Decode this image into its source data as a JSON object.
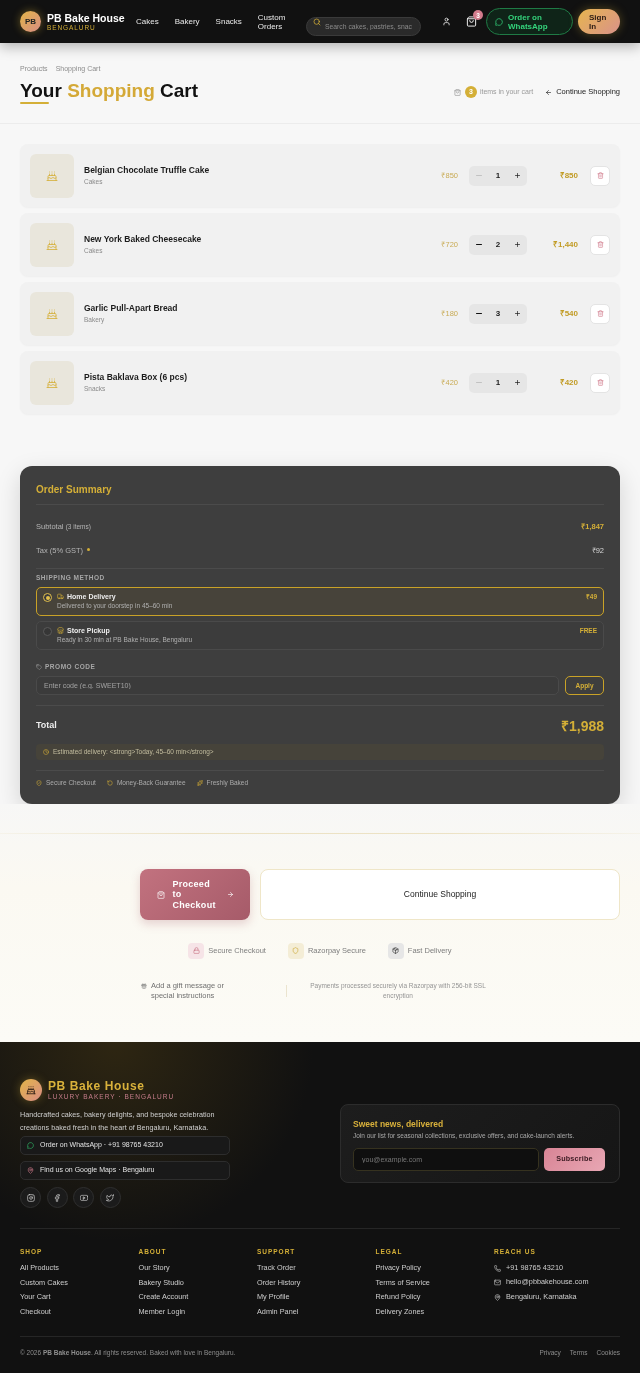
{
  "header": {
    "logo": {
      "initials": "PB",
      "name": "PB Bake House",
      "city": "BENGALURU"
    },
    "nav": [
      "Cakes",
      "Bakery",
      "Snacks",
      "Custom Orders"
    ],
    "search": {
      "placeholder": "Search cakes, pastries, snac"
    },
    "cart_count": "3",
    "whatsapp_button": "Order on WhatsApp",
    "sign_in_button": "Sign In"
  },
  "breadcrumb": [
    "Products",
    "Shopping Cart"
  ],
  "title": {
    "before": "Your",
    "highlight": "Shopping",
    "after": "Cart"
  },
  "cart_info": {
    "count": "3",
    "label": "items in your cart",
    "continue_link": "Continue Shopping"
  },
  "cart_items": [
    {
      "name": "Belgian Chocolate Truffle Cake",
      "category": "Cakes",
      "unit_price": "₹850",
      "quantity": "1",
      "total": "₹850",
      "decrease_disabled": true
    },
    {
      "name": "New York Baked Cheesecake",
      "category": "Cakes",
      "unit_price": "₹720",
      "quantity": "2",
      "total": "₹1,440",
      "decrease_disabled": false
    },
    {
      "name": "Garlic Pull-Apart Bread",
      "category": "Bakery",
      "unit_price": "₹180",
      "quantity": "3",
      "total": "₹540",
      "decrease_disabled": false
    },
    {
      "name": "Pista Baklava Box (6 pcs)",
      "category": "Snacks",
      "unit_price": "₹420",
      "quantity": "1",
      "total": "₹420",
      "decrease_disabled": true
    }
  ],
  "order_summary": {
    "title": "Order Summary",
    "subtotal": {
      "label": "Subtotal",
      "note": "(3 items)",
      "value": "₹1,847"
    },
    "tax": {
      "label": "Tax (5% GST)",
      "value": "₹92"
    },
    "shipping": {
      "label": "SHIPPING METHOD",
      "options": [
        {
          "name": "Home Delivery",
          "description": "Delivered to your doorstep in 45–60 min",
          "price": "₹49",
          "selected": true
        },
        {
          "name": "Store Pickup",
          "description": "Ready in 30 min at PB Bake House, Bengaluru",
          "price": "FREE",
          "selected": false
        }
      ]
    },
    "promo": {
      "label": "PROMO CODE",
      "placeholder": "Enter code (e.g. SWEET10)",
      "button": "Apply"
    },
    "total": {
      "label": "Total",
      "value": "₹1,988"
    },
    "estimate": "Estimated delivery: <strong>Today, 45–60 min</strong>",
    "assurances": [
      "Secure Checkout",
      "Money-Back Guarantee",
      "Freshly Baked"
    ]
  },
  "checkout_actions": {
    "proceed_button": "Proceed to Checkout",
    "continue_button": "Continue Shopping"
  },
  "trust_badges": [
    "Secure Checkout",
    "Razorpay Secure",
    "Fast Delivery"
  ],
  "gift_link": "Add a gift message or special instructions",
  "payment_note": "Payments processed securely via Razorpay with 256-bit SSL encryption",
  "footer": {
    "brand": {
      "name": "PB Bake House",
      "tagline": "LUXURY BAKERY · BENGALURU"
    },
    "description": "Handcrafted cakes, bakery delights, and bespoke celebration creations baked fresh in the heart of Bengaluru, Karnataka.",
    "contact_links": [
      "Order on WhatsApp · +91 98765 43210",
      "Find us on Google Maps · Bengaluru"
    ],
    "newsletter": {
      "title": "Sweet news, delivered",
      "text": "Join our list for seasonal collections, exclusive offers, and cake-launch alerts.",
      "placeholder": "you@example.com",
      "button": "Subscribe"
    },
    "columns": [
      {
        "heading": "SHOP",
        "links": [
          "All Products",
          "Custom Cakes",
          "Your Cart",
          "Checkout"
        ]
      },
      {
        "heading": "ABOUT",
        "links": [
          "Our Story",
          "Bakery Studio",
          "Create Account",
          "Member Login"
        ]
      },
      {
        "heading": "SUPPORT",
        "links": [
          "Track Order",
          "Order History",
          "My Profile",
          "Admin Panel"
        ]
      },
      {
        "heading": "LEGAL",
        "links": [
          "Privacy Policy",
          "Terms of Service",
          "Refund Policy",
          "Delivery Zones"
        ]
      }
    ],
    "contact": {
      "heading": "REACH US",
      "items": [
        "+91 98765 43210",
        "hello@pbbakehouse.com",
        "Bengaluru, Karnataka"
      ]
    },
    "copyright": "© 2026 **PB Bake House**. All rights reserved. Baked with love in Bengaluru.",
    "legal_links": [
      "Privacy",
      "Terms",
      "Cookies"
    ]
  }
}
